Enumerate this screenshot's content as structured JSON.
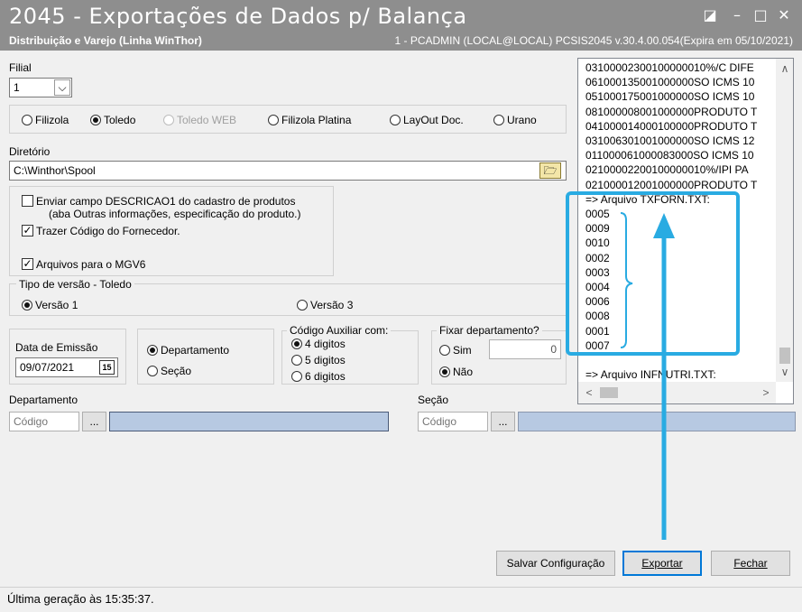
{
  "window": {
    "title": "2045 - Exportações de Dados p/ Balança",
    "subtitle_left": "Distribuição e Varejo (Linha WinThor)",
    "subtitle_right": "1 - PCADMIN (LOCAL@LOCAL)   PCSIS2045  v.30.4.00.054(Expira em 05/10/2021)",
    "btn_restore": "◪",
    "btn_min": "–",
    "btn_max": "□",
    "btn_close": "✕"
  },
  "filial": {
    "label": "Filial",
    "value": "1",
    "arrow": "⌵"
  },
  "layout_options": [
    {
      "label": "Filizola",
      "selected": false,
      "disabled": false
    },
    {
      "label": "Toledo",
      "selected": true,
      "disabled": false
    },
    {
      "label": "Toledo WEB",
      "selected": false,
      "disabled": true
    },
    {
      "label": "Filizola Platina",
      "selected": false,
      "disabled": false
    },
    {
      "label": "LayOut Doc.",
      "selected": false,
      "disabled": false
    },
    {
      "label": "Urano",
      "selected": false,
      "disabled": false
    }
  ],
  "diretorio": {
    "label": "Diretório",
    "value": "C:\\Winthor\\Spool",
    "folder_icon": "🗁"
  },
  "checks": {
    "descricao_line1": "Enviar campo DESCRICAO1 do cadastro de produtos",
    "descricao_line2": "(aba Outras informações, especificação do produto.)",
    "descricao_checked": false,
    "fornecedor": "Trazer Código do Fornecedor.",
    "fornecedor_checked": true,
    "mgv6": "Arquivos para o MGV6",
    "mgv6_checked": true,
    "check_glyph": "✓"
  },
  "tipo_versao": {
    "label": "Tipo de versão - Toledo",
    "v1": "Versão 1",
    "v3": "Versão 3"
  },
  "data_emissao": {
    "label": "Data de Emissão",
    "value": "09/07/2021",
    "cal_icon": "15"
  },
  "agrupamento": {
    "departamento": "Departamento",
    "secao": "Seção"
  },
  "codigo_aux": {
    "label": "Código Auxiliar com:",
    "d4": "4 digitos",
    "d5": "5 digitos",
    "d6": "6 digitos"
  },
  "fixar_dep": {
    "label": "Fixar departamento?",
    "sim": "Sim",
    "nao": "Não",
    "value": "0"
  },
  "departamento": {
    "label": "Departamento",
    "placeholder": "Código",
    "btn": "..."
  },
  "secao": {
    "label": "Seção",
    "placeholder": "Código",
    "btn": "..."
  },
  "log_lines": [
    "03100002300100000010%/C DIFE",
    "061000135001000000SO ICMS 10",
    "051000175001000000SO ICMS 10",
    "081000008001000000PRODUTO T",
    "041000014000100000PRODUTO T",
    "031006301001000000SO ICMS 12",
    "011000061000083000SO ICMS 10",
    "02100002200100000010%/IPI PA",
    "021000012001000000PRODUTO T",
    "=> Arquivo TXFORN.TXT:",
    "0005",
    "0009",
    "0010",
    "0002",
    "0003",
    "0004",
    "0006",
    "0008",
    "0001",
    "0007",
    "",
    "=> Arquivo INFNUTRI.TXT:"
  ],
  "scroll": {
    "up": "∧",
    "down": "∨",
    "left": "<",
    "right": ">"
  },
  "buttons": {
    "salvar": "Salvar Configuração",
    "exportar": "Exportar",
    "fechar": "Fechar"
  },
  "status": "Última geração às 15:35:37.",
  "colors": {
    "highlight": "#29abe2",
    "titlebar": "#8e8e8e",
    "field_blue": "#b7c9e2"
  }
}
